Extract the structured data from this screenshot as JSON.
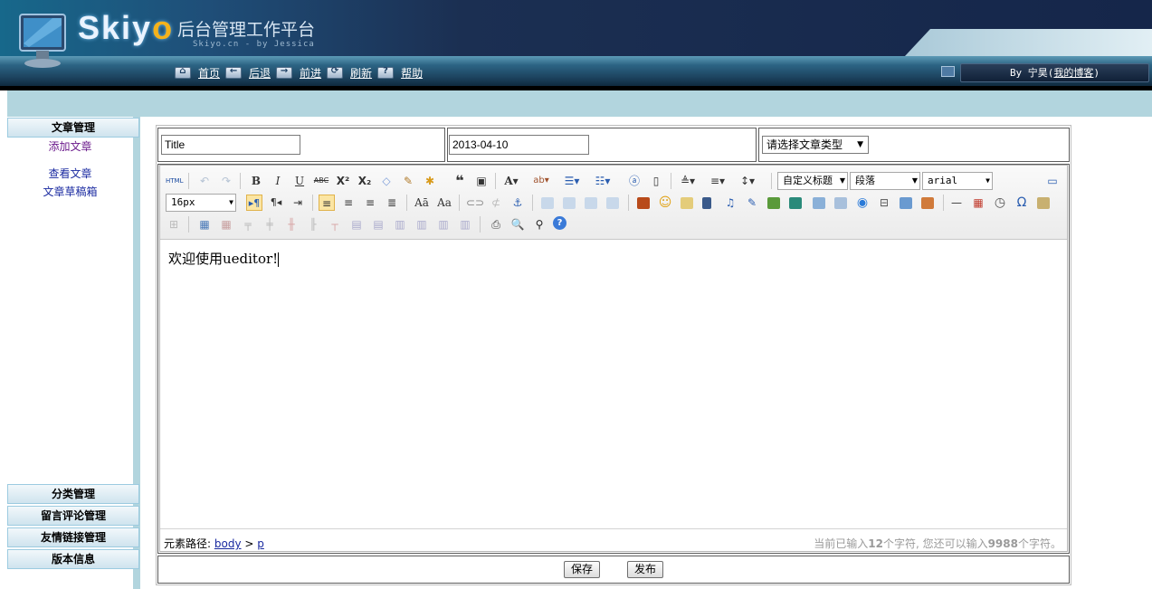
{
  "header": {
    "logo_text": "Skiyo",
    "subtitle": "后台管理工作平台",
    "credit": "Skiyo.cn - by Jessica",
    "nav": [
      {
        "label": "首页",
        "icon": "home-icon"
      },
      {
        "label": "后退",
        "icon": "back-arrow-icon"
      },
      {
        "label": "前进",
        "icon": "forward-arrow-icon"
      },
      {
        "label": "刷新",
        "icon": "refresh-icon"
      },
      {
        "label": "帮助",
        "icon": "help-icon"
      }
    ],
    "user_prefix": "By 宁昊(",
    "user_link": "我的博客",
    "user_suffix": ")"
  },
  "sidebar": {
    "sections": [
      {
        "title": "文章管理",
        "items": [
          "添加文章",
          "查看文章",
          "文章草稿箱"
        ]
      },
      {
        "title": "分类管理"
      },
      {
        "title": "留言评论管理"
      },
      {
        "title": "友情链接管理"
      },
      {
        "title": "版本信息"
      }
    ]
  },
  "form": {
    "title_value": "Title",
    "date_value": "2013-04-10",
    "category_select": "请选择文章类型"
  },
  "editor": {
    "font_size": "16px",
    "heading_combo": "自定义标题",
    "paragraph_combo": "段落",
    "font_combo": "arial",
    "content": "欢迎使用ueditor!",
    "path_label": "元素路径:",
    "path_body": "body",
    "path_sep": " > ",
    "path_p": "p",
    "count_prefix": "当前已输入",
    "count_typed": "12",
    "count_middle": "个字符, 您还可以输入",
    "count_remaining": "9988",
    "count_suffix": "个字符。"
  },
  "buttons": {
    "save": "保存",
    "publish": "发布"
  }
}
